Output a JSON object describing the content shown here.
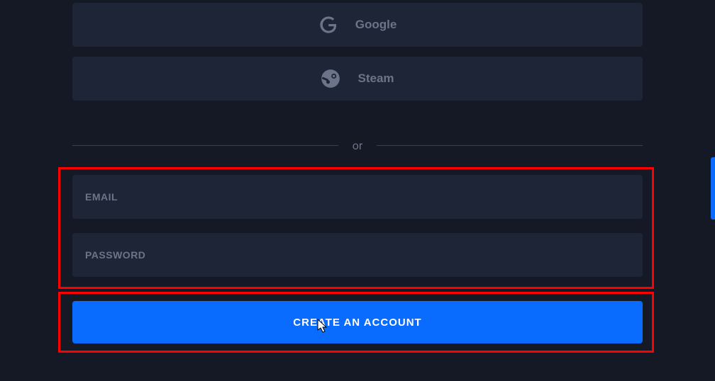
{
  "social": {
    "google_label": "Google",
    "steam_label": "Steam"
  },
  "divider_text": "or",
  "form": {
    "email_placeholder": "EMAIL",
    "password_placeholder": "PASSWORD",
    "submit_label": "CREATE AN ACCOUNT"
  },
  "colors": {
    "background": "#141925",
    "panel": "#1e2536",
    "accent": "#0a6bff",
    "text_muted": "#6b7489",
    "highlight": "#ff0000"
  }
}
